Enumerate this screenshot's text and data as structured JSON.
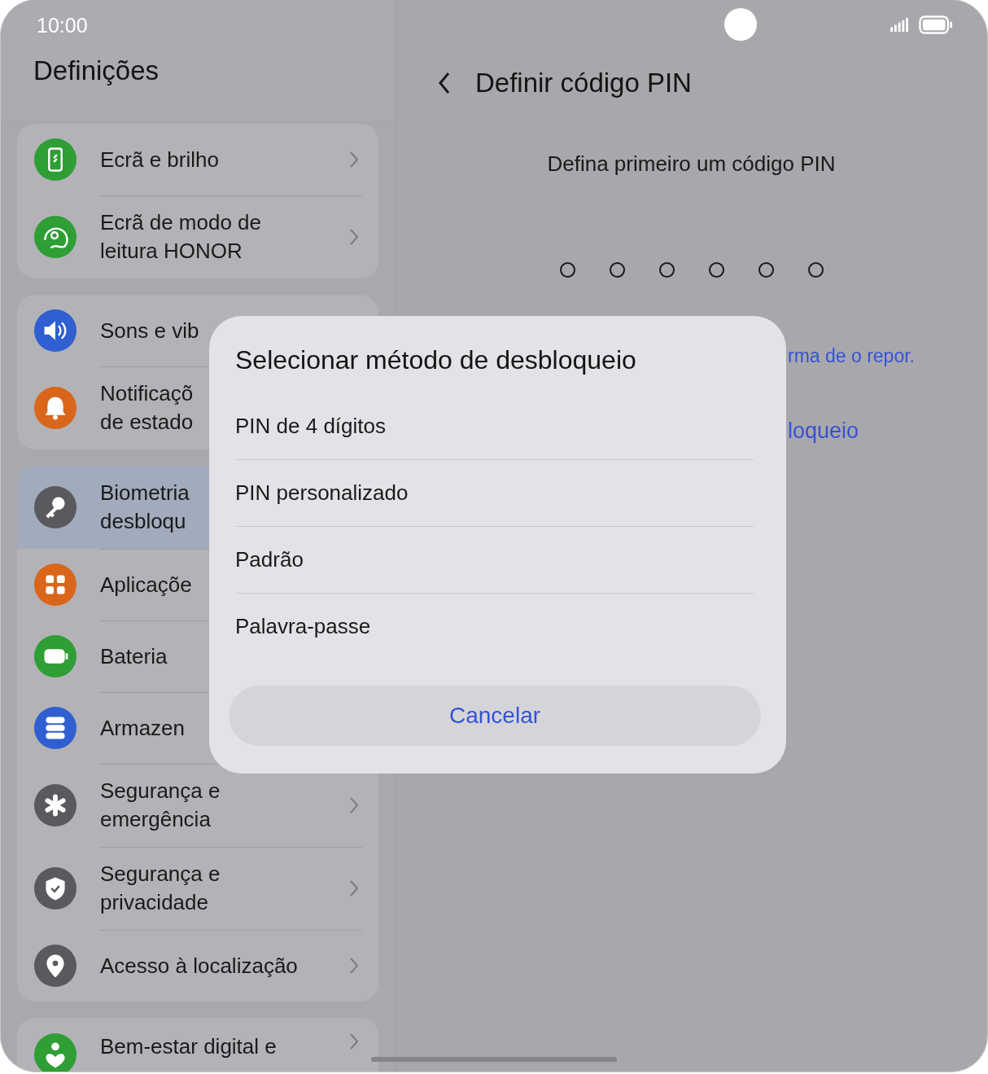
{
  "status_bar": {
    "time": "10:00"
  },
  "settings": {
    "title": "Definições",
    "groups": [
      {
        "items": [
          {
            "lines": [
              "Ecrã e brilho"
            ],
            "color": "#2e9e35",
            "selected": false,
            "chevron": true
          },
          {
            "lines": [
              "Ecrã de modo de",
              "leitura HONOR"
            ],
            "color": "#2e9e35",
            "selected": false,
            "chevron": true
          }
        ]
      },
      {
        "items": [
          {
            "lines": [
              "Sons e vib"
            ],
            "color": "#2f5fd0",
            "selected": false,
            "chevron": false
          },
          {
            "lines": [
              "Notificaçõ",
              "de estado"
            ],
            "color": "#d9661a",
            "selected": false,
            "chevron": false
          }
        ]
      },
      {
        "items": [
          {
            "lines": [
              "Biometria",
              "desbloqu"
            ],
            "color": "#5a5a5e",
            "selected": true,
            "chevron": false
          },
          {
            "lines": [
              "Aplicaçõe"
            ],
            "color": "#d9661a",
            "selected": false,
            "chevron": false
          },
          {
            "lines": [
              "Bateria"
            ],
            "color": "#2e9e35",
            "selected": false,
            "chevron": false
          },
          {
            "lines": [
              "Armazen"
            ],
            "color": "#2f5fd0",
            "selected": false,
            "chevron": false
          },
          {
            "lines": [
              "Segurança e",
              "emergência"
            ],
            "color": "#5a5a5e",
            "selected": false,
            "chevron": true
          },
          {
            "lines": [
              "Segurança e",
              "privacidade"
            ],
            "color": "#5a5a5e",
            "selected": false,
            "chevron": true
          },
          {
            "lines": [
              "Acesso à localização"
            ],
            "color": "#5a5a5e",
            "selected": false,
            "chevron": true
          }
        ]
      },
      {
        "items": [
          {
            "lines": [
              "Bem-estar digital e"
            ],
            "color": "#2e9e35",
            "selected": false,
            "chevron": true
          }
        ]
      }
    ]
  },
  "pin_page": {
    "title": "Definir código PIN",
    "prompt": "Defina primeiro um código PIN",
    "pin_dots": [
      {
        "filled": false
      },
      {
        "filled": false
      },
      {
        "filled": false
      },
      {
        "filled": false
      },
      {
        "filled": false
      },
      {
        "filled": false
      }
    ],
    "hint_text": "rma de o repor.",
    "link": "loqueio"
  },
  "dialog": {
    "title": "Selecionar método de desbloqueio",
    "options": [
      "PIN de 4 dígitos",
      "PIN personalizado",
      "Padrão",
      "Palavra-passe"
    ],
    "cancel": "Cancelar"
  }
}
